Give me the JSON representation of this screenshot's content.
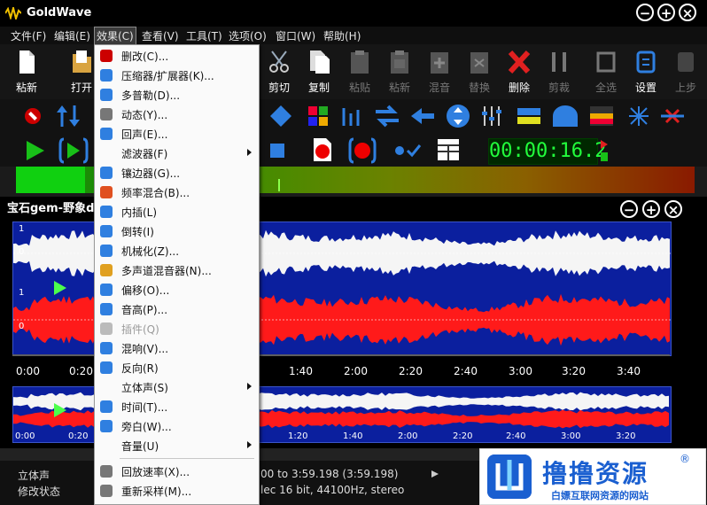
{
  "app": {
    "title": "GoldWave"
  },
  "menubar": [
    "文件(F)",
    "编辑(E)",
    "效果(C)",
    "查看(V)",
    "工具(T)",
    "选项(O)",
    "窗口(W)",
    "帮助(H)"
  ],
  "toolbar": {
    "items": [
      {
        "label": "粘新",
        "icon": "new-file-icon"
      },
      {
        "label": "打开",
        "icon": "open-folder-icon"
      },
      {
        "label": "剪切",
        "icon": "scissors-icon"
      },
      {
        "label": "复制",
        "icon": "copy-icon"
      },
      {
        "label": "粘贴",
        "icon": "paste-icon",
        "disabled": true
      },
      {
        "label": "粘新",
        "icon": "paste-new-icon",
        "disabled": true
      },
      {
        "label": "混音",
        "icon": "mix-icon",
        "disabled": true
      },
      {
        "label": "替换",
        "icon": "replace-icon",
        "disabled": true
      },
      {
        "label": "删除",
        "icon": "delete-icon"
      },
      {
        "label": "剪裁",
        "icon": "trim-icon",
        "disabled": true
      },
      {
        "label": "全选",
        "icon": "select-all-icon",
        "disabled": true
      },
      {
        "label": "设置",
        "icon": "settings-icon"
      },
      {
        "label": "上步",
        "icon": "undo-icon",
        "disabled": true
      }
    ]
  },
  "timer": {
    "value": "00:00:16.2"
  },
  "wave": {
    "title": "宝石gem-野象d",
    "channel_labels": [
      "1",
      "0",
      "1",
      "0"
    ],
    "timeline": [
      "0:00",
      "0:20",
      "1:40",
      "2:00",
      "2:20",
      "2:40",
      "3:00",
      "3:20",
      "3:40"
    ],
    "overview_timeline": [
      "0:00",
      "0:20",
      "1:20",
      "1:40",
      "2:00",
      "2:20",
      "2:40",
      "3:00",
      "3:20"
    ]
  },
  "status": {
    "channel": "立体声",
    "state": "修改状态",
    "range": "00 to 3:59.198 (3:59.198)",
    "format": "lec 16 bit, 44100Hz, stereo"
  },
  "effects_menu": {
    "items": [
      {
        "label": "删改(C)...",
        "icon": "cd-icon"
      },
      {
        "label": "压缩器/扩展器(K)...",
        "icon": "compressor-icon"
      },
      {
        "label": "多普勒(D)...",
        "icon": "doppler-icon"
      },
      {
        "label": "动态(Y)...",
        "icon": "dynamics-icon"
      },
      {
        "label": "回声(E)...",
        "icon": "echo-icon"
      },
      {
        "label": "滤波器(F)",
        "icon": "",
        "submenu": true
      },
      {
        "label": "镶边器(G)...",
        "icon": "flanger-icon"
      },
      {
        "label": "频率混合(B)...",
        "icon": "frequency-mix-icon"
      },
      {
        "label": "内插(L)",
        "icon": "interpolate-icon"
      },
      {
        "label": "倒转(I)",
        "icon": "invert-icon"
      },
      {
        "label": "机械化(Z)...",
        "icon": "mechanize-icon"
      },
      {
        "label": "多声道混音器(N)...",
        "icon": "channel-mixer-icon"
      },
      {
        "label": "偏移(O)...",
        "icon": "offset-icon"
      },
      {
        "label": "音高(P)...",
        "icon": "pitch-icon"
      },
      {
        "label": "插件(Q)",
        "icon": "plugin-icon",
        "disabled": true
      },
      {
        "label": "混响(V)...",
        "icon": "reverb-icon"
      },
      {
        "label": "反向(R)",
        "icon": "reverse-icon"
      },
      {
        "label": "立体声(S)",
        "icon": "",
        "submenu": true
      },
      {
        "label": "时间(T)...",
        "icon": "clock-icon"
      },
      {
        "label": "旁白(W)...",
        "icon": "voiceover-icon"
      },
      {
        "label": "音量(U)",
        "icon": "",
        "submenu": true
      },
      {
        "label": "回放速率(X)...",
        "icon": "playback-rate-icon"
      },
      {
        "label": "重新采样(M)...",
        "icon": "resample-icon"
      }
    ]
  },
  "watermark": {
    "title": "撸撸资源",
    "subtitle": "白嫖互联网资源的网站",
    "reg": "®"
  }
}
